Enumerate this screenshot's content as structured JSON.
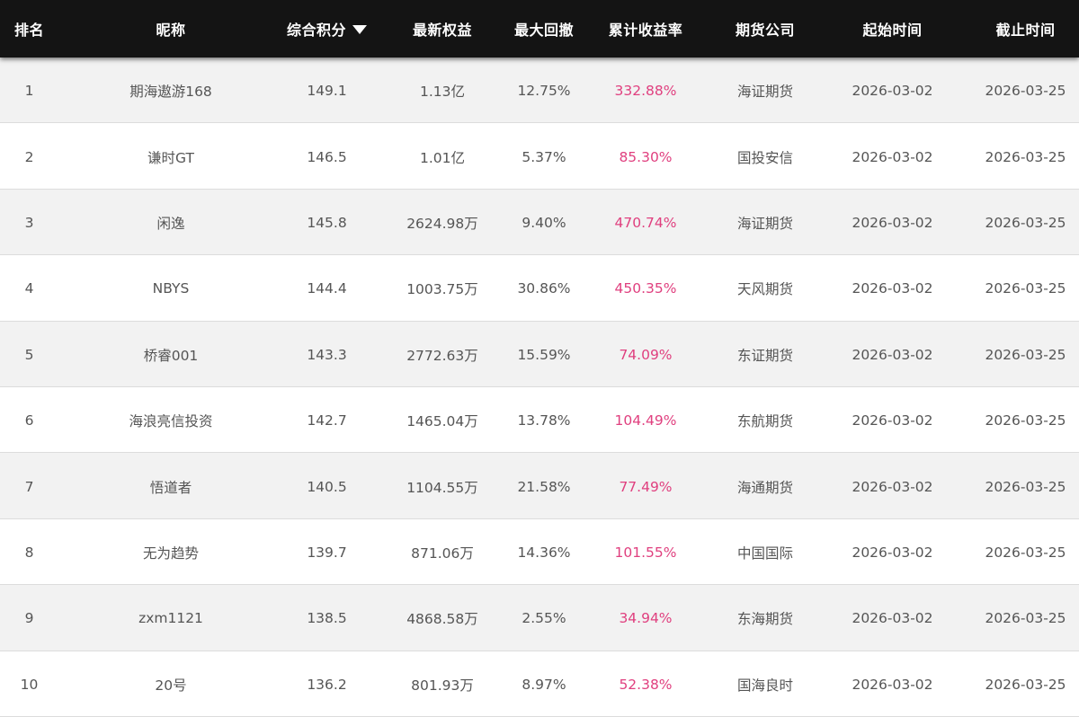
{
  "headers": {
    "rank": "排名",
    "name": "昵称",
    "score": "综合积分",
    "equity": "最新权益",
    "drawdown": "最大回撤",
    "rate": "累计收益率",
    "company": "期货公司",
    "start": "起始时间",
    "end": "截止时间"
  },
  "sort_icon": "triangle-down-icon",
  "colors": {
    "header_bg": "#141414",
    "rate_text": "#e0407f",
    "row_alt": "#f2f2f2"
  },
  "rows": [
    {
      "rank": "1",
      "name": "期海遨游168",
      "score": "149.1",
      "equity": "1.13亿",
      "drawdown": "12.75%",
      "rate": "332.88%",
      "company": "海证期货",
      "start": "2026-03-02",
      "end": "2026-03-25"
    },
    {
      "rank": "2",
      "name": "谦时GT",
      "score": "146.5",
      "equity": "1.01亿",
      "drawdown": "5.37%",
      "rate": "85.30%",
      "company": "国投安信",
      "start": "2026-03-02",
      "end": "2026-03-25"
    },
    {
      "rank": "3",
      "name": "闲逸",
      "score": "145.8",
      "equity": "2624.98万",
      "drawdown": "9.40%",
      "rate": "470.74%",
      "company": "海证期货",
      "start": "2026-03-02",
      "end": "2026-03-25"
    },
    {
      "rank": "4",
      "name": "NBYS",
      "score": "144.4",
      "equity": "1003.75万",
      "drawdown": "30.86%",
      "rate": "450.35%",
      "company": "天风期货",
      "start": "2026-03-02",
      "end": "2026-03-25"
    },
    {
      "rank": "5",
      "name": "桥睿001",
      "score": "143.3",
      "equity": "2772.63万",
      "drawdown": "15.59%",
      "rate": "74.09%",
      "company": "东证期货",
      "start": "2026-03-02",
      "end": "2026-03-25"
    },
    {
      "rank": "6",
      "name": "海浪亮信投资",
      "score": "142.7",
      "equity": "1465.04万",
      "drawdown": "13.78%",
      "rate": "104.49%",
      "company": "东航期货",
      "start": "2026-03-02",
      "end": "2026-03-25"
    },
    {
      "rank": "7",
      "name": "悟道者",
      "score": "140.5",
      "equity": "1104.55万",
      "drawdown": "21.58%",
      "rate": "77.49%",
      "company": "海通期货",
      "start": "2026-03-02",
      "end": "2026-03-25"
    },
    {
      "rank": "8",
      "name": "无为趋势",
      "score": "139.7",
      "equity": "871.06万",
      "drawdown": "14.36%",
      "rate": "101.55%",
      "company": "中国国际",
      "start": "2026-03-02",
      "end": "2026-03-25"
    },
    {
      "rank": "9",
      "name": "zxm1121",
      "score": "138.5",
      "equity": "4868.58万",
      "drawdown": "2.55%",
      "rate": "34.94%",
      "company": "东海期货",
      "start": "2026-03-02",
      "end": "2026-03-25"
    },
    {
      "rank": "10",
      "name": "20号",
      "score": "136.2",
      "equity": "801.93万",
      "drawdown": "8.97%",
      "rate": "52.38%",
      "company": "国海良时",
      "start": "2026-03-02",
      "end": "2026-03-25"
    }
  ]
}
